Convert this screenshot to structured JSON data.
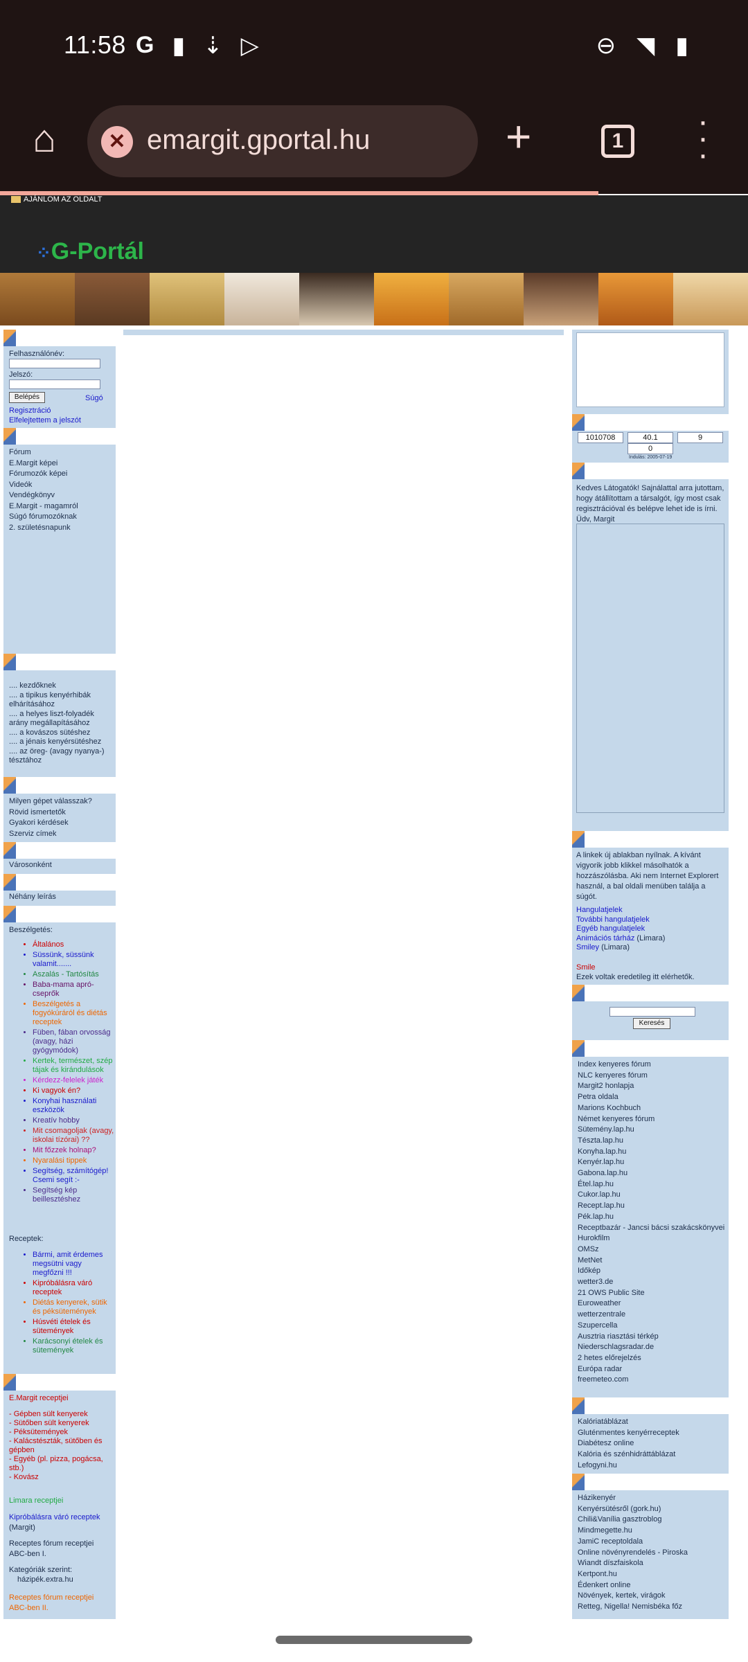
{
  "status": {
    "time": "11:58",
    "left_icons": [
      "google-icon",
      "clipboard-icon",
      "download-icon",
      "play-store-icon"
    ],
    "right_icons": [
      "do-not-disturb-icon",
      "wifi-icon",
      "battery-icon"
    ]
  },
  "browser": {
    "url": "emargit.gportal.hu",
    "tab_count": "1",
    "load_progress": 0.8
  },
  "site": {
    "recommend": "AJÁNLOM AZ OLDALT",
    "logo": "G-Portál"
  },
  "login": {
    "username_label": "Felhasználónév:",
    "password_label": "Jelszó:",
    "login_button": "Belépés",
    "help": "Súgó",
    "register": "Regisztráció",
    "forgot": "Elfelejtettem a jelszót"
  },
  "left_nav": [
    "Fórum",
    "E.Margit képei",
    "Fórumozók képei",
    "Videók",
    "Vendégkönyv",
    "E.Margit - magamról",
    "Súgó fórumozóknak",
    "2. születésnapunk"
  ],
  "beginner_links": [
    ".... kezdőknek",
    ".... a tipikus kenyérhibák elhárításához",
    ".... a helyes liszt-folyadék arány megállapításához",
    ".... a kovászos sütéshez",
    ".... a jénais kenyérsütéshez",
    ".... az öreg- (avagy nyanya-) tésztához"
  ],
  "machine_links": [
    "Milyen gépet válasszak?",
    "Rövid ismertetők",
    "Gyakori kérdések",
    "Szerviz címek"
  ],
  "cities": "Városonként",
  "descriptions": "Néhány leírás",
  "forum": {
    "conversations_label": "Beszélgetés:",
    "conversations": [
      {
        "text": "Általános",
        "color": "#cc0000"
      },
      {
        "text": "Süssünk, süssünk valamit.......",
        "color": "#1a1acc"
      },
      {
        "text": "Aszalás - Tartósítás",
        "color": "#228844"
      },
      {
        "text": "Baba-mama apró-cseprők",
        "color": "#661166"
      },
      {
        "text": "Beszélgetés a fogyókúráról és diétás receptek",
        "color": "#ee6600"
      },
      {
        "text": "Füben, fában orvosság (avagy, házi gyógymódok)",
        "color": "#4b2a8a"
      },
      {
        "text": "Kertek, természet, szép tájak és kirándulások",
        "color": "#22aa44"
      },
      {
        "text": "Kérdezz-felelek játék",
        "color": "#cc22cc"
      },
      {
        "text": "Ki vagyok én?",
        "color": "#cc0000"
      },
      {
        "text": "Konyhai használati eszközök",
        "color": "#1a1acc"
      },
      {
        "text": "Kreatív hobby",
        "color": "#4b2a8a"
      },
      {
        "text": "Mit csomagoljak (avagy, iskolai tízórai) ??",
        "color": "#cc2222"
      },
      {
        "text": "Mit főzzek holnap?",
        "color": "#aa1177"
      },
      {
        "text": "Nyaralási tippek",
        "color": "#ee6600"
      },
      {
        "text": "Segítség, számítógép! Csemi segít :-",
        "color": "#1a1acc"
      },
      {
        "text": "Segítség kép beillesztéshez",
        "color": "#4b2a8a"
      }
    ],
    "recipes_label": "Receptek:",
    "recipes": [
      {
        "text": "Bármi, amit érdemes megsütni vagy megfőzni !!!",
        "color": "#1a1acc"
      },
      {
        "text": "Kipróbálásra váró receptek",
        "color": "#cc0000"
      },
      {
        "text": "Diétás kenyerek, sütik és péksütemények",
        "color": "#ee6600"
      },
      {
        "text": "Húsvéti ételek és sütemények",
        "color": "#cc0000"
      },
      {
        "text": "Karácsonyi ételek és sütemények",
        "color": "#228844"
      }
    ]
  },
  "recipes_box": {
    "title": "E.Margit receptjei",
    "items": [
      "- Gépben sült kenyerek",
      "- Sütőben sült kenyerek",
      "- Péksütemények",
      "- Kalácstészták, sütőben és gépben",
      "- Egyéb (pl. pizza, pogácsa, stb.)",
      "- Kovász"
    ],
    "limara": "Limara receptjei",
    "waiting": "Kipróbálásra váró receptek",
    "waiting_suffix": " (Margit)",
    "abc1": "Receptes fórum receptjei ABC-ben I.",
    "categories_label": "Kategóriák szerint:",
    "hazipek": "házipék.extra.hu",
    "abc2": "Receptes fórum receptjei ABC-ben II."
  },
  "counters": {
    "total": "1010708",
    "online": "40.1",
    "today": "9",
    "visitors": "0",
    "since": "Indulás: 2005-07-19"
  },
  "welcome": "Kedves Látogatók! Sajnálattal arra jutottam, hogy átállítottam a társalgót, így most csak regisztrációval és belépve lehet ide is írni. Üdv, Margit",
  "links_note": "A linkek új ablakban nyílnak. A kívánt vigyorik jobb klikkel másolhatók a hozzászólásba. Aki nem Internet Explorert használ, a bal oldali menüben találja a súgót.",
  "smiley_links": [
    {
      "text": "Hangulatjelek",
      "suffix": ""
    },
    {
      "text": "További hangulatjelek",
      "suffix": ""
    },
    {
      "text": "Egyéb hangulatjelek",
      "suffix": ""
    },
    {
      "text": "Animációs tárház",
      "suffix": " (Limara)"
    },
    {
      "text": "Smiley",
      "suffix": " (Limara)"
    }
  ],
  "smile": "Smile",
  "smile_note": "Ezek voltak eredetileg itt elérhetők.",
  "search_button": "Keresés",
  "web_links": [
    "Index kenyeres fórum",
    "NLC kenyeres fórum",
    "Margit2 honlapja",
    "Petra oldala",
    "Marions Kochbuch",
    "Német kenyeres fórum",
    "Sütemény.lap.hu",
    "Tészta.lap.hu",
    "Konyha.lap.hu",
    "Kenyér.lap.hu",
    "Gabona.lap.hu",
    "Étel.lap.hu",
    "Cukor.lap.hu",
    "Recept.lap.hu",
    "Pék.lap.hu",
    "Receptbazár - Jancsi bácsi szakácskönyvei",
    "Hurokfilm",
    "OMSz",
    "MetNet",
    "Időkép",
    "wetter3.de",
    "21 OWS Public Site",
    "Euroweather",
    "wetterzentrale",
    "Szupercella",
    "Ausztria riasztási térkép",
    "Niederschlagsradar.de",
    "2 hetes előrejelzés",
    "Európa radar",
    "freemeteo.com"
  ],
  "diet_links": [
    "Kalóriatáblázat",
    "Gluténmentes kenyérreceptek",
    "Diabétesz online",
    "Kalória és szénhidráttáblázat",
    "Lefogyni.hu"
  ],
  "other_links": [
    "Házikenyér",
    "Kenyérsütésről (gork.hu)",
    "Chili&Vanília gasztroblog",
    "Mindmegette.hu",
    "JamiC receptoldala",
    "Online növényrendelés - Piroska",
    "Wiandt díszfaiskola",
    "Kertpont.hu",
    "Édenkert online",
    "Növények, kertek, virágok",
    "Retteg, Nigella! Nemisbéka főz"
  ]
}
